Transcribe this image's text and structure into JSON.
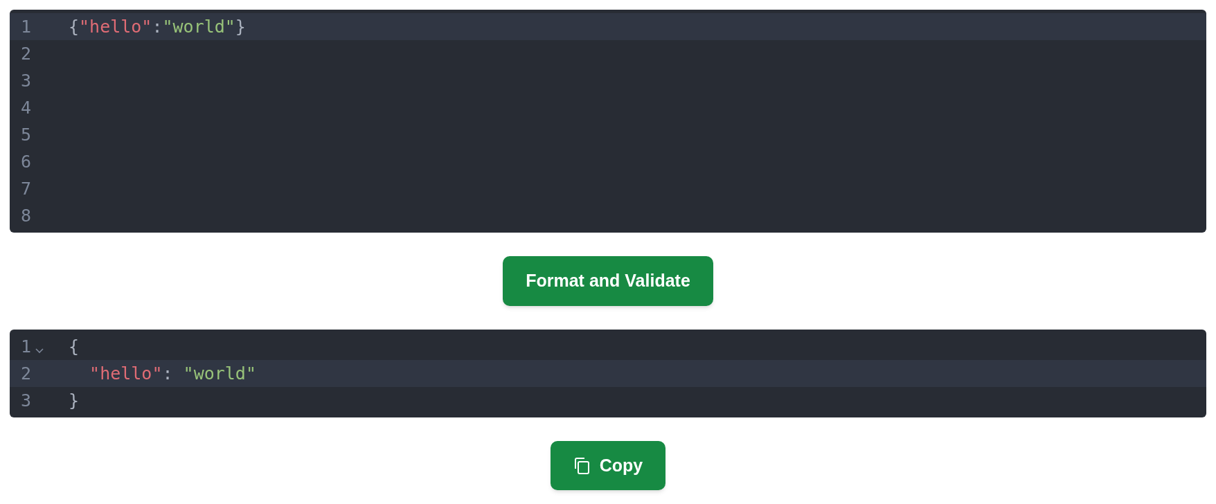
{
  "input_editor": {
    "lines": [
      {
        "number": "1",
        "active": true,
        "tokens": [
          {
            "kind": "punct",
            "text": "{"
          },
          {
            "kind": "key",
            "text": "\"hello\""
          },
          {
            "kind": "punct",
            "text": ":"
          },
          {
            "kind": "string",
            "text": "\"world\""
          },
          {
            "kind": "punct",
            "text": "}"
          }
        ]
      },
      {
        "number": "2",
        "active": false
      },
      {
        "number": "3",
        "active": false
      },
      {
        "number": "4",
        "active": false
      },
      {
        "number": "5",
        "active": false
      },
      {
        "number": "6",
        "active": false
      },
      {
        "number": "7",
        "active": false
      },
      {
        "number": "8",
        "active": false
      }
    ]
  },
  "format_button": {
    "label": "Format and Validate"
  },
  "output_editor": {
    "lines": [
      {
        "number": "1",
        "active": false,
        "foldable": true,
        "tokens": [
          {
            "kind": "punct",
            "text": "{"
          }
        ]
      },
      {
        "number": "2",
        "active": true,
        "foldable": false,
        "tokens": [
          {
            "kind": "key",
            "text": "  \"hello\""
          },
          {
            "kind": "punct",
            "text": ": "
          },
          {
            "kind": "string",
            "text": "\"world\""
          }
        ]
      },
      {
        "number": "3",
        "active": false,
        "foldable": false,
        "tokens": [
          {
            "kind": "punct",
            "text": "}"
          }
        ]
      }
    ]
  },
  "copy_button": {
    "label": "Copy"
  }
}
